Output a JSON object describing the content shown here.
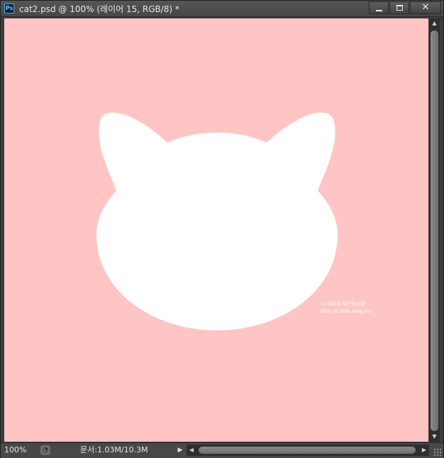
{
  "window": {
    "app_icon": "Ps",
    "title": "cat2.psd @ 100% (레이어 15, RGB/8) *",
    "controls": {
      "minimize_icon": "minimize-icon",
      "maximize_icon": "maximize-icon",
      "close_icon": "close-icon",
      "close_glyph": "✕"
    }
  },
  "canvas": {
    "background_color": "#fec5c4",
    "shape_color": "#ffffff",
    "watermark": {
      "line1": "ⓒ 파요의 작은천사회",
      "line2": "http://csflife.blog.me"
    }
  },
  "statusbar": {
    "zoom": "100%",
    "doc_size": "문서:1.03M/10.3M",
    "arrow_glyph": "▶",
    "icon": "document-info-icon"
  },
  "scrollbars": {
    "up_glyph": "▲",
    "down_glyph": "▼",
    "left_glyph": "◀",
    "right_glyph": "▶"
  }
}
